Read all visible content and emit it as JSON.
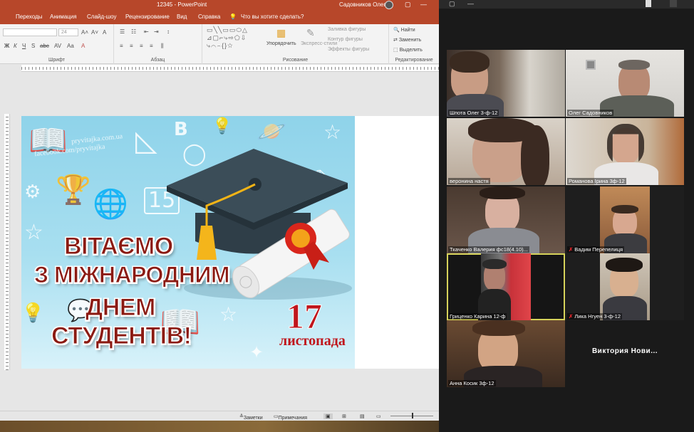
{
  "powerpoint": {
    "title": "12345  -  PowerPoint",
    "user": "Садовников Олег",
    "window_buttons": [
      "▢",
      "—",
      "▢",
      "✕"
    ],
    "tabs": [
      "Переходы",
      "Анимация",
      "Слайд-шоу",
      "Рецензирование",
      "Вид",
      "Справка",
      "Что вы хотите сделать?"
    ],
    "ribbon": {
      "font_group": "Шрифт",
      "font_size": "24",
      "paragraph_group": "Абзац",
      "drawing_group": "Рисование",
      "arrange": "Упорядочить",
      "express_styles": "Экспресс-стили",
      "shape_fill": "Заливка фигуры",
      "shape_outline": "Контур фигуры",
      "shape_effects": "Эффекты фигуры",
      "find": "Найти",
      "replace": "Заменить",
      "select": "Выделить",
      "editing_group": "Редактирование"
    },
    "slide": {
      "watermark_1": "pryvitajka.com.ua",
      "watermark_2": "facebook.com/pryvitajka",
      "greeting_lines": [
        "ВІТАЄМО",
        "З МІЖНАРОДНИМ",
        "ДНЕМ",
        "СТУДЕНТІВ!"
      ],
      "date_number": "17",
      "date_month": "листопада",
      "doodle_number": "15",
      "doodle_letter": "B"
    },
    "statusbar": {
      "notes": "Заметки",
      "comments": "Примечания"
    }
  },
  "zoom": {
    "participants": [
      {
        "name": "Шпота Олег 3-ф-12",
        "muted": false
      },
      {
        "name": "Олег Садовников",
        "muted": false
      },
      {
        "name": "веронина настя",
        "muted": false
      },
      {
        "name": "Романова Ірина 3ф-12",
        "muted": false
      },
      {
        "name": "Ткаченко Валерия фс18(4.10)...",
        "muted": false
      },
      {
        "name": "Вадим Перепелиця",
        "muted": true
      },
      {
        "name": "Гриценко Карина 12-ф",
        "muted": false
      },
      {
        "name": "Лика Нгуен 3-ф-12",
        "muted": true
      },
      {
        "name": "Анна Косик 3ф-12",
        "muted": false
      },
      {
        "name": "Виктория Нови...",
        "muted": false
      }
    ],
    "active_speaker": "Гриценко Карина 12-ф",
    "mute_icon": "✗"
  }
}
